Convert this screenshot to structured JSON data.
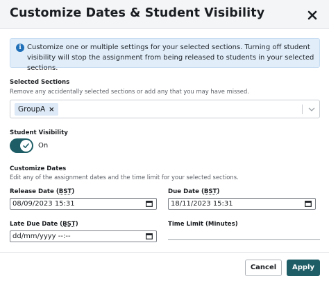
{
  "dialog": {
    "title": "Customize Dates & Student Visibility",
    "close_icon": "close-icon"
  },
  "info": {
    "icon": "info-icon",
    "text": "Customize one or multiple settings for your selected sections. Turning off student visibility will stop the assignment from being released to students in your selected sections."
  },
  "sections": {
    "label": "Selected Sections",
    "help": "Remove any accidentally selected sections or add any that you may have missed.",
    "tags": [
      {
        "label": "GroupA",
        "remove": "×"
      }
    ],
    "dropdown_icon": "chevron-down-icon"
  },
  "visibility": {
    "label": "Student Visibility",
    "toggle_on": true,
    "state_text": "On"
  },
  "dates": {
    "label": "Customize Dates",
    "help": "Edit any of the assignment dates and the time limit for your selected sections.",
    "release": {
      "label": "Release Date",
      "tz": "BST",
      "value": "08/09/2023 15:31"
    },
    "due": {
      "label": "Due Date",
      "tz": "BST",
      "value": "18/11/2023 15:31"
    },
    "late_due": {
      "label": "Late Due Date",
      "tz": "BST",
      "value": "dd/mm/yyyy --:--"
    },
    "time_limit": {
      "label": "Time Limit (Minutes)",
      "value": ""
    }
  },
  "footer": {
    "cancel_label": "Cancel",
    "apply_label": "Apply"
  },
  "colors": {
    "primary": "#1e5d66",
    "info_bg": "#e1eefa",
    "info_icon": "#1f6fb8",
    "tag_bg": "#dde9f6"
  }
}
